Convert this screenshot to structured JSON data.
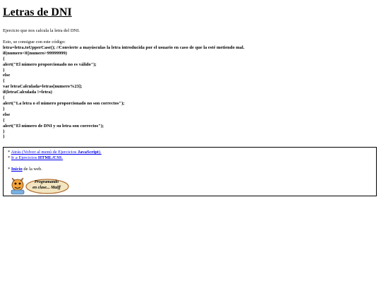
{
  "page": {
    "title": "Letras de DNI",
    "description": "Ejercicio que nos calcula la letra del DNI.",
    "intro": "Esto, se consigue con este código:"
  },
  "code_lines": [
    {
      "text": "letra=letra.toUpperCase(); //Convierte a mayúsculas la letra introducida por el usuario en caso de que la esté metiendo mal.",
      "bold": true
    },
    {
      "text": "if(numero<0||numero>99999999)",
      "bold": true
    },
    {
      "text": "{",
      "bold": true
    },
    {
      "text": "alert(\"El número proporcionado no es válido\");",
      "bold": true
    },
    {
      "text": "}",
      "bold": true
    },
    {
      "text": "else",
      "bold": true
    },
    {
      "text": "{",
      "bold": true
    },
    {
      "text": "var letraCalculada=letras[numero%23];",
      "bold": true
    },
    {
      "text": "if(letraCalculada !=letra)",
      "bold": true
    },
    {
      "text": "{",
      "bold": true
    },
    {
      "text": "alert(\"La letra o el número proporcionado no son correctos\");",
      "bold": true
    },
    {
      "text": "}",
      "bold": true
    },
    {
      "text": "else",
      "bold": true
    },
    {
      "text": "{",
      "bold": true
    },
    {
      "text": "alert(\"El número de DNI y su letra son correctos\");",
      "bold": true
    },
    {
      "text": "}",
      "bold": true
    },
    {
      "text": "}",
      "bold": true
    }
  ],
  "links": {
    "back_prefix": "* ",
    "back_text": "Atrás (Volver al menú de Ejercicios ",
    "back_bold": "JavaScript",
    "back_suffix": ").",
    "html_prefix": "* ",
    "html_text": "Ir a Ejercicios ",
    "html_bold": "HTML/CSS",
    "html_suffix": ".",
    "home_prefix": "* ",
    "home_bold": "Inicio",
    "home_text": " de la web."
  },
  "badge": {
    "line1": "Programando",
    "line2": "en clase... Maiff"
  },
  "colors": {
    "link": "#0000ee",
    "badge_fill": "#f3e5c0",
    "badge_border": "#b06a2a",
    "mascot": "#f2a33a"
  }
}
